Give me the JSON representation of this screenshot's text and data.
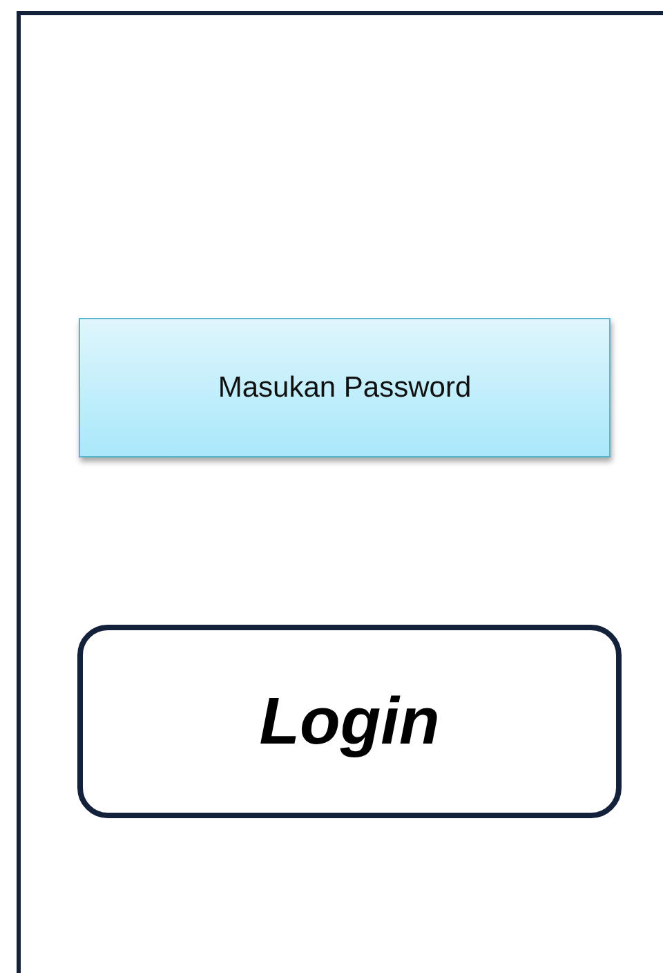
{
  "password_field": {
    "placeholder": "Masukan Password"
  },
  "login_button": {
    "label": "Login"
  }
}
